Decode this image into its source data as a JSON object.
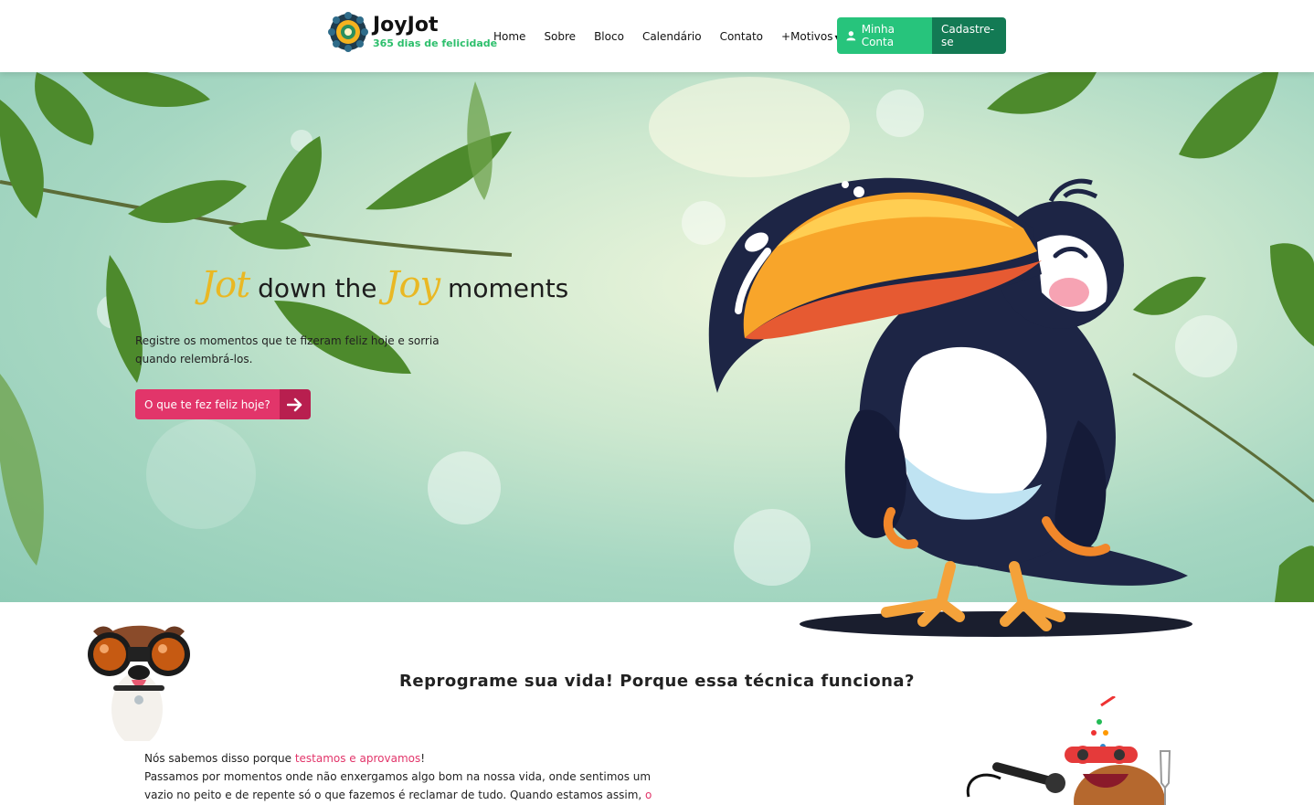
{
  "brand": {
    "title": "JoyJot",
    "tagline": "365 dias de felicidade"
  },
  "nav": {
    "items": [
      "Home",
      "Sobre",
      "Bloco",
      "Calendário",
      "Contato",
      "+Motivos"
    ],
    "account_label": "Minha Conta",
    "signup_label": "Cadastre-se"
  },
  "hero": {
    "title_script_1": "Jot",
    "title_plain_1": "down the",
    "title_script_2": "Joy",
    "title_plain_2": "moments",
    "description": "Registre os momentos que te fizeram feliz hoje e sorria quando relembrá-los.",
    "cta_label": "O que te fez feliz hoje?"
  },
  "section": {
    "title": "Reprograme sua vida! Porque essa técnica funciona?",
    "line1_prefix": "Nós sabemos disso porque ",
    "line1_link": "testamos e aprovamos",
    "line1_suffix": "!",
    "line2": "Passamos por momentos onde não enxergamos algo bom na nossa vida, onde sentimos um vazio no peito e de repente só o que fazemos é reclamar de tudo. Quando estamos assim, ",
    "line2_link": "o"
  },
  "colors": {
    "accent_green": "#27c47c",
    "dark_green": "#137a54",
    "cta_pink": "#e2356a",
    "script_yellow": "#e9b824"
  },
  "icons": [
    "logo-icon",
    "user-icon",
    "caret-down-icon",
    "arrow-right-icon"
  ]
}
